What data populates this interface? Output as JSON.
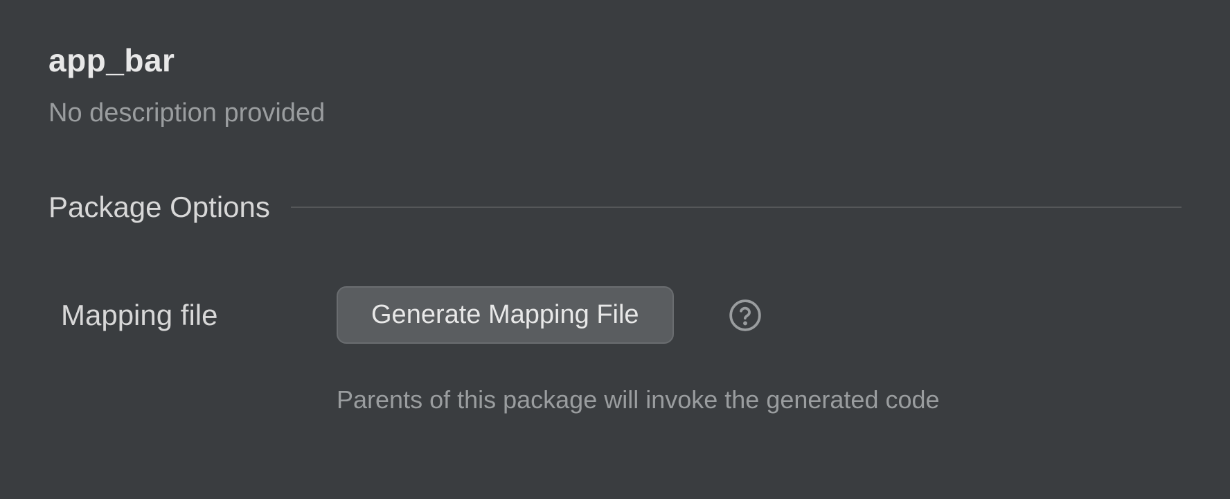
{
  "package": {
    "title": "app_bar",
    "description": "No description provided"
  },
  "section": {
    "title": "Package Options"
  },
  "options": {
    "mapping_file": {
      "label": "Mapping file",
      "button_label": "Generate Mapping File",
      "helper_text": "Parents of this package will invoke the generated code"
    }
  }
}
